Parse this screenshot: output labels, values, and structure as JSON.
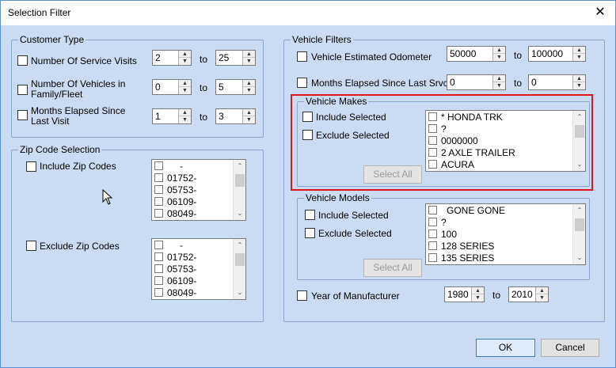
{
  "window": {
    "title": "Selection Filter",
    "close_glyph": "✕"
  },
  "customer_type": {
    "legend": "Customer Type",
    "rows": [
      {
        "label": "Number Of Service Visits",
        "from": "2",
        "to": "25"
      },
      {
        "label": "Number Of Vehicles in Family/Fleet",
        "from": "0",
        "to": "5"
      },
      {
        "label": "Months Elapsed Since Last Visit",
        "from": "1",
        "to": "3"
      }
    ],
    "to_label": "to"
  },
  "zip": {
    "legend": "Zip Code Selection",
    "include_label": "Include Zip Codes",
    "exclude_label": "Exclude Zip Codes",
    "items": [
      "-",
      "01752-",
      "05753-",
      "06109-",
      "08049-"
    ]
  },
  "vehicle_filters": {
    "legend": "Vehicle Filters",
    "odometer_label": "Vehicle Estimated Odometer",
    "odometer_from": "50000",
    "odometer_to": "100000",
    "months_label": "Months Elapsed Since Last Srvc",
    "months_from": "0",
    "months_to": "0",
    "to_label": "to",
    "year_label": "Year of Manufacturer",
    "year_from": "1980",
    "year_to": "2010"
  },
  "makes": {
    "legend": "Vehicle Makes",
    "include_label": "Include Selected",
    "exclude_label": "Exclude Selected",
    "select_all": "Select All",
    "items": [
      "* HONDA TRK",
      "?",
      "0000000",
      "2 AXLE TRAILER",
      "ACURA"
    ]
  },
  "models": {
    "legend": "Vehicle Models",
    "include_label": "Include Selected",
    "exclude_label": "Exclude Selected",
    "select_all": "Select All",
    "items": [
      "GONE GONE",
      "?",
      "100",
      "128 SERIES",
      "135 SERIES"
    ]
  },
  "footer": {
    "ok": "OK",
    "cancel": "Cancel"
  },
  "colors": {
    "dialog_bg": "#c9dcf3",
    "highlight": "#e3141b",
    "ok_border": "#3c7fb1"
  },
  "icons": {
    "spin_up": "▲",
    "spin_down": "▼",
    "scroll_up": "⌃",
    "scroll_down": "⌄"
  }
}
